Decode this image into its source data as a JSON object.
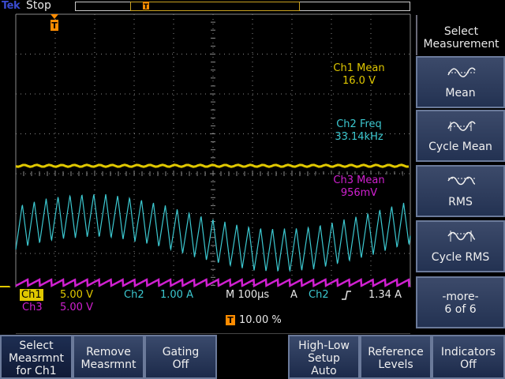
{
  "topbar": {
    "brand": "Tek",
    "run_state": "Stop"
  },
  "measurements": {
    "ch1": {
      "label": "Ch1 Mean",
      "value": "16.0 V"
    },
    "ch2": {
      "label": "Ch2 Freq",
      "value": "33.14kHz"
    },
    "ch3": {
      "label": "Ch3 Mean",
      "value": "956mV"
    }
  },
  "status": {
    "ch1_label": "Ch1",
    "ch1_scale": "5.00 V",
    "ch2_label": "Ch2",
    "ch2_scale": "1.00 A",
    "ch3_label": "Ch3",
    "ch3_scale": "5.00 V",
    "timebase": "M 100µs",
    "trig_mode": "A",
    "trig_source": "Ch2",
    "trig_level": "1.34 A",
    "trig_marker": "T",
    "trig_position": "10.00 %",
    "ch1_marker": "1"
  },
  "side_menu": {
    "header_line1": "Select",
    "header_line2": "Measurement",
    "items": [
      {
        "label": "Mean",
        "icon": "mean-waveform-icon"
      },
      {
        "label": "Cycle Mean",
        "icon": "cycle-mean-waveform-icon"
      },
      {
        "label": "RMS",
        "icon": "rms-waveform-icon"
      },
      {
        "label": "Cycle RMS",
        "icon": "cycle-rms-waveform-icon"
      }
    ],
    "more_line1": "-more-",
    "more_line2": "6 of 6"
  },
  "bottom_menu": [
    {
      "line1": "Select",
      "line2": "Measrmnt",
      "line3": "for Ch1"
    },
    {
      "line1": "Remove",
      "line2": "Measrmnt",
      "line3": ""
    },
    {
      "line1": "Gating",
      "line2": "Off",
      "line3": ""
    },
    {
      "line1": "High-Low",
      "line2": "Setup",
      "line3": "Auto"
    },
    {
      "line1": "Reference",
      "line2": "Levels",
      "line3": ""
    },
    {
      "line1": "Indicators",
      "line2": "Off",
      "line3": ""
    }
  ],
  "colors": {
    "ch1": "#e0c800",
    "ch2": "#3cc8d0",
    "ch3": "#d020d0",
    "trigger": "#ff8c00",
    "grid": "#888888"
  }
}
